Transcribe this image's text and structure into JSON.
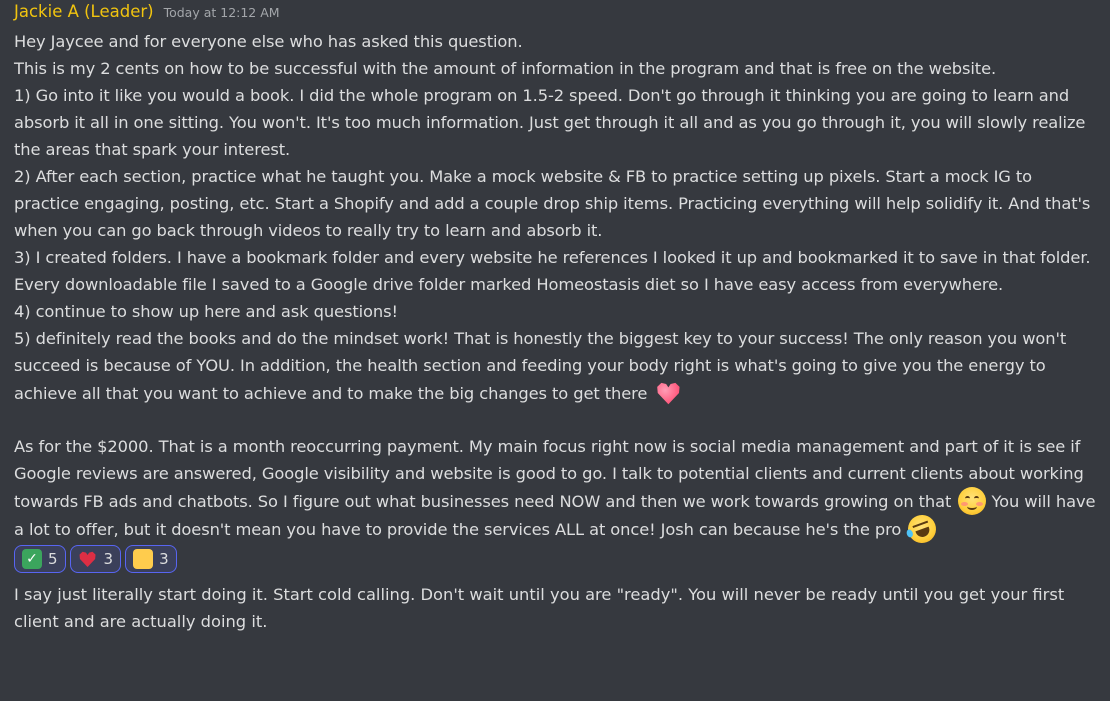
{
  "message": {
    "author": "Jackie A (Leader)",
    "timestamp": "Today at 12:12 AM",
    "paragraphs": [
      "Hey Jaycee and for everyone else who has asked this question.",
      "This is my 2 cents on how to be successful with the amount of information in the program and that is free on the website.",
      "1) Go into it like you would a book. I did the whole program on 1.5-2 speed. Don't go through it thinking you are going to learn and absorb it all in one sitting. You won't. It's too much information. Just get through it all and as you go through it, you will slowly realize the areas that spark your interest.",
      "2) After each section, practice what he taught you. Make a mock website &  FB to practice setting up pixels. Start a mock IG to practice engaging, posting, etc. Start a Shopify and add a couple drop ship items. Practicing everything will help solidify it. And that's when you can go back through videos to really try to learn and absorb it.",
      "3) I created folders. I have a bookmark folder and every website he references I looked it up and bookmarked it to save in that folder. Every downloadable file I saved to a Google drive folder marked Homeostasis diet so I have easy access from everywhere.",
      "4) continue to show up here and ask questions!",
      "5) definitely read the books and do the mindset work! That is honestly the biggest key to your success! The only reason you won't succeed is because of YOU. In addition, the health section and feeding your body right is what's going to give you the energy to achieve all that you want to achieve and to make the big changes to get there",
      "As for the $2000. That is a month reoccurring payment. My main focus right now is social media management and part of it is see if Google reviews are answered,  Google visibility and website is good to go.  I talk to potential clients and current clients about working towards FB ads and chatbots. So I figure out what businesses need NOW and then we work towards growing on that",
      " You will have a lot to offer, but it doesn't mean you have to provide the services ALL at once! Josh can because he's the pro"
    ],
    "emojis": [
      "heart-emoji",
      "smiling-face-emoji",
      "rolling-laughing-emoji"
    ],
    "reactions": [
      {
        "icon": "check-mark-icon",
        "count": "5"
      },
      {
        "icon": "heart-icon",
        "count": "3"
      },
      {
        "icon": "thumbs-up-icon",
        "count": "3"
      }
    ]
  },
  "followup": {
    "text": "I say just literally start doing it. Start cold calling. Don't wait until you are \"ready\". You will never be ready until you get your first client and are actually doing it."
  }
}
